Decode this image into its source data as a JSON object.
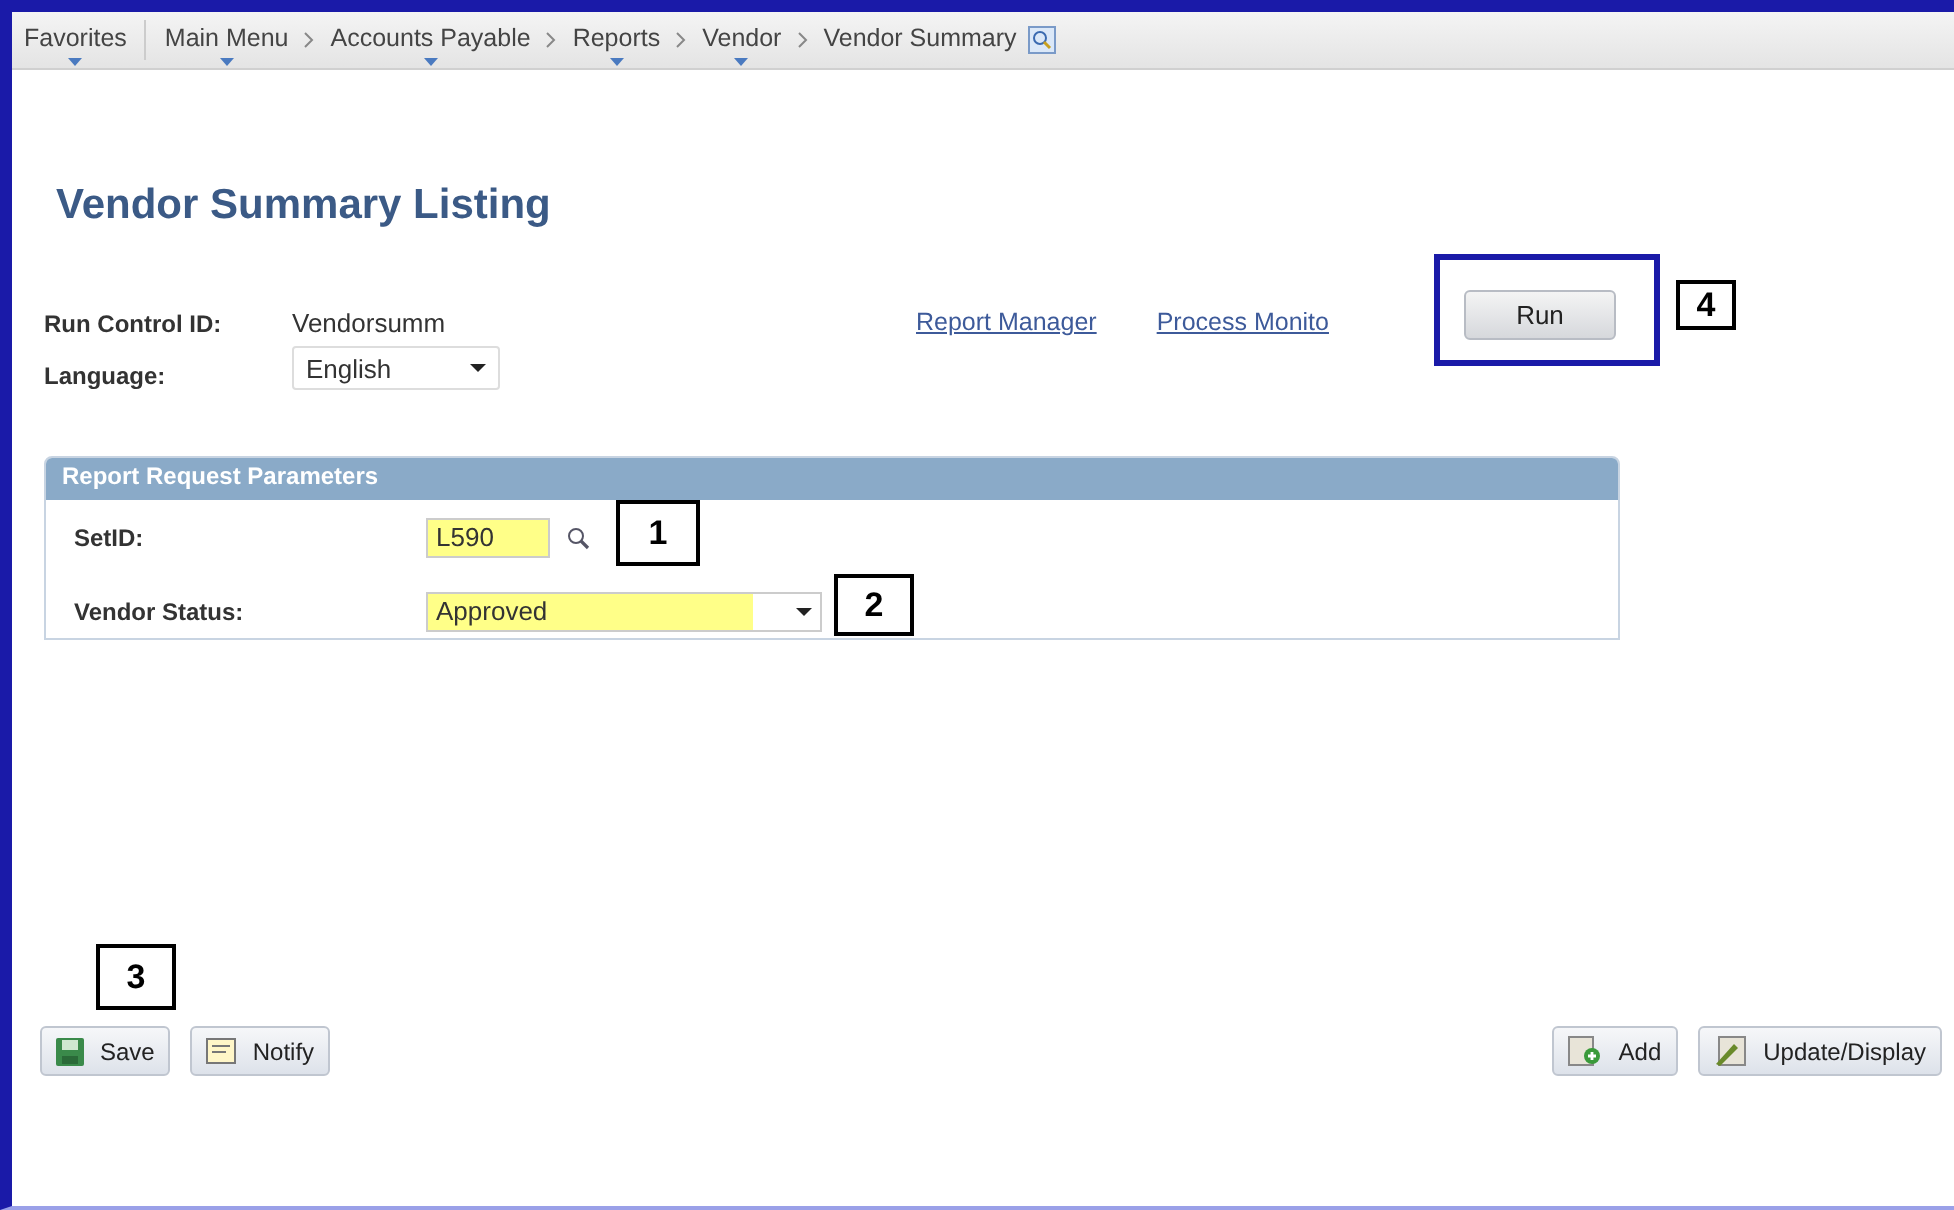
{
  "breadcrumbs": [
    {
      "label": "Favorites",
      "menu": true
    },
    {
      "label": "Main Menu",
      "menu": true
    },
    {
      "label": "Accounts Payable",
      "menu": true
    },
    {
      "label": "Reports",
      "menu": true
    },
    {
      "label": "Vendor",
      "menu": true
    },
    {
      "label": "Vendor Summary",
      "menu": false
    }
  ],
  "title": "Vendor Summary Listing",
  "run_control": {
    "label": "Run Control ID:",
    "value": "Vendorsumm"
  },
  "language": {
    "label": "Language:",
    "value": "English"
  },
  "links": [
    "Report Manager",
    "Process Monito"
  ],
  "run_button": "Run",
  "panel": {
    "title": "Report Request Parameters",
    "setid": {
      "label": "SetID:",
      "value": "L590"
    },
    "vendor_status": {
      "label": "Vendor Status:",
      "value": "Approved"
    }
  },
  "callouts": [
    "1",
    "2",
    "3",
    "4"
  ],
  "left_buttons": [
    {
      "label": "Save",
      "kind": "save"
    },
    {
      "label": "Notify",
      "kind": "notify"
    }
  ],
  "right_buttons": [
    {
      "label": "Add",
      "kind": "add"
    },
    {
      "label": "Update/Display",
      "kind": "update"
    }
  ]
}
